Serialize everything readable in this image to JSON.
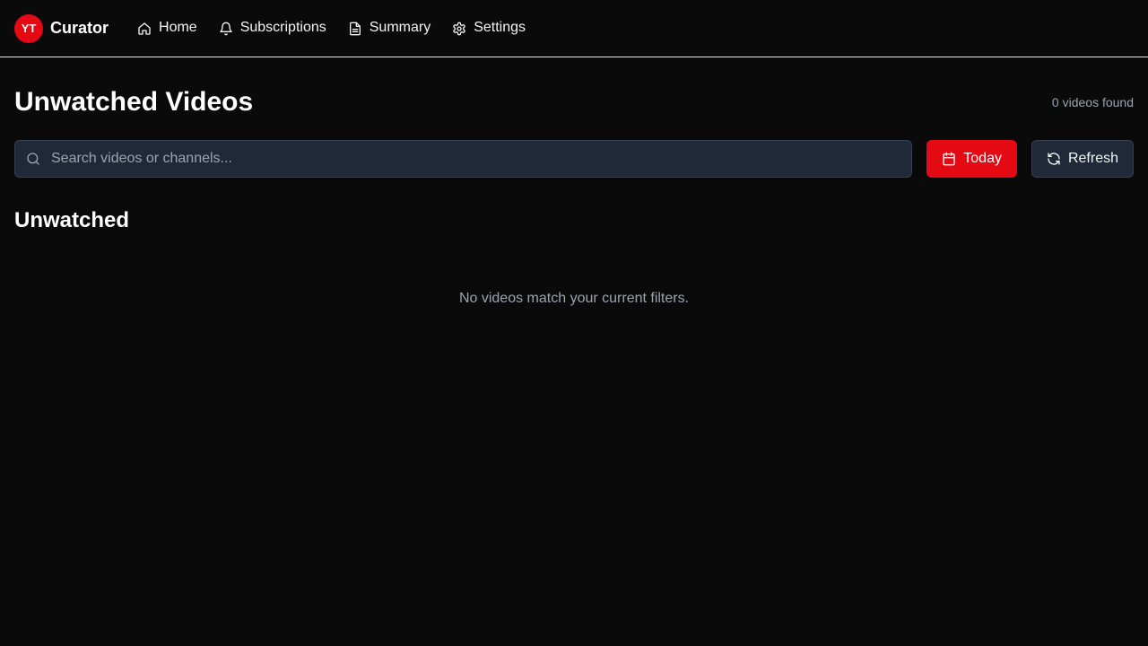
{
  "brand": {
    "badge": "YT",
    "name": "Curator",
    "badge_color": "#e50914"
  },
  "nav": [
    {
      "label": "Home",
      "icon": "home-icon"
    },
    {
      "label": "Subscriptions",
      "icon": "bell-icon"
    },
    {
      "label": "Summary",
      "icon": "document-icon"
    },
    {
      "label": "Settings",
      "icon": "gear-icon"
    }
  ],
  "header": {
    "title": "Unwatched Videos",
    "count_text": "0 videos found"
  },
  "search": {
    "placeholder": "Search videos or channels...",
    "value": ""
  },
  "buttons": {
    "today_label": "Today",
    "refresh_label": "Refresh"
  },
  "section": {
    "title": "Unwatched",
    "empty_message": "No videos match your current filters."
  },
  "colors": {
    "accent": "#e50914",
    "background": "#0a0a0b",
    "input_bg": "#1f2937"
  }
}
